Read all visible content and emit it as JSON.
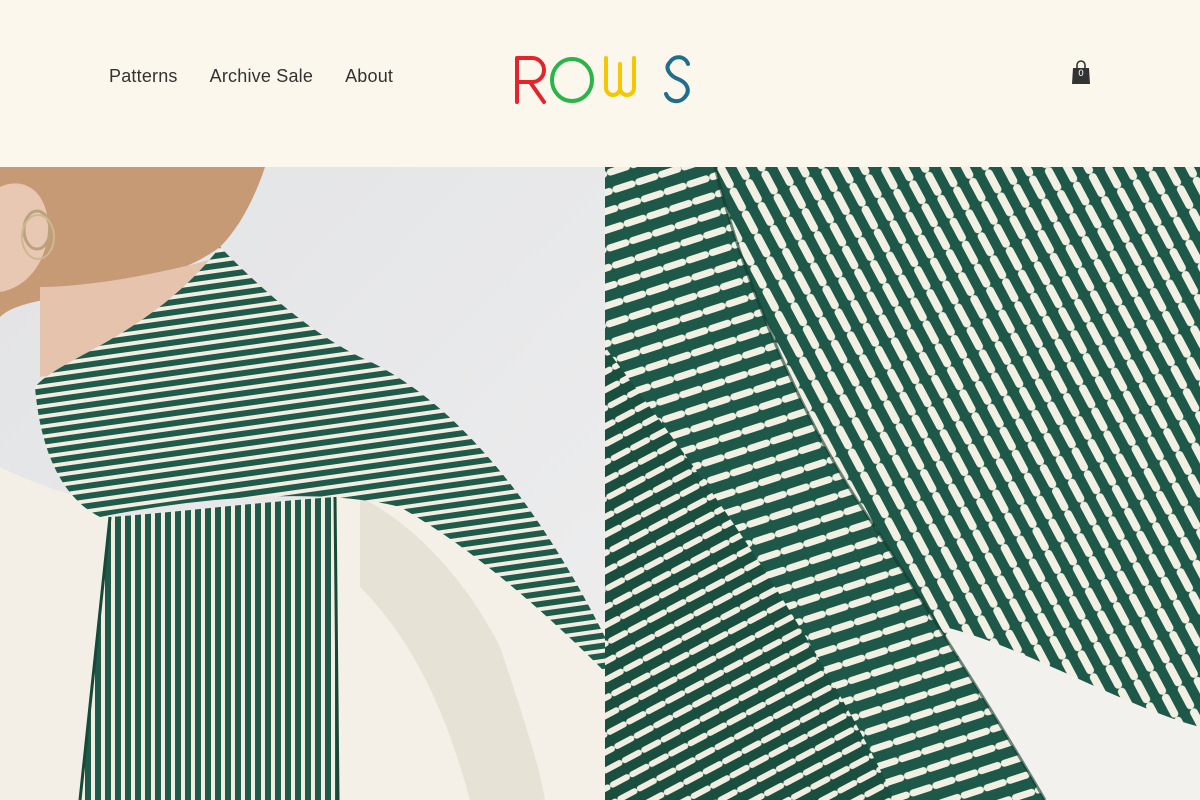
{
  "nav": {
    "items": [
      {
        "label": "Patterns"
      },
      {
        "label": "Archive Sale"
      },
      {
        "label": "About"
      }
    ]
  },
  "logo": {
    "text": "ROWS",
    "colors": [
      "#e3242b",
      "#2bb44a",
      "#f6c700",
      "#1f6e8c"
    ]
  },
  "cart": {
    "count": "0",
    "icon": "shopping-bag-icon"
  },
  "colors": {
    "background": "#fbf7ec",
    "knit_green": "#1f5a4a",
    "knit_cream": "#f4f0e3"
  }
}
